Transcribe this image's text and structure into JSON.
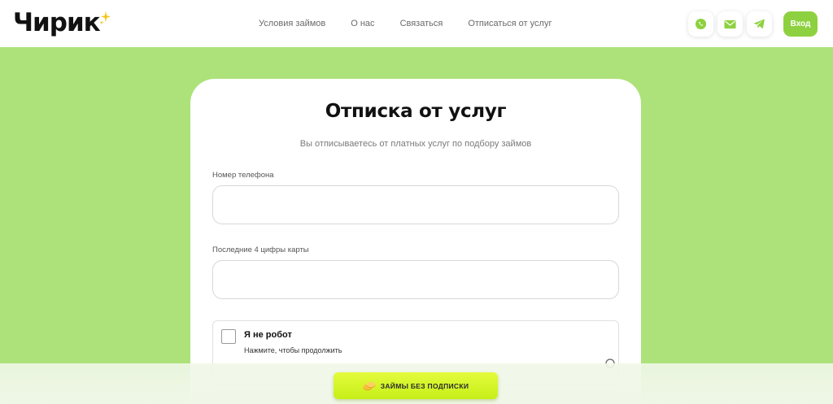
{
  "header": {
    "logo_text": "Чирик",
    "nav": [
      {
        "label": "Условия займов"
      },
      {
        "label": "О нас"
      },
      {
        "label": "Связаться"
      },
      {
        "label": "Отписаться от услуг"
      }
    ],
    "contact_icons": [
      "whatsapp-icon",
      "mail-icon",
      "telegram-icon"
    ],
    "login_label": "Вход"
  },
  "form": {
    "title": "Отписка от услуг",
    "subtitle": "Вы отписываетесь от платных услуг по подбору займов",
    "phone_label": "Номер телефона",
    "phone_value": "",
    "card_label": "Последние 4 цифры карты",
    "card_value": ""
  },
  "captcha": {
    "title": "Я не робот",
    "subtitle": "Нажмите, чтобы продолжить",
    "checked": false
  },
  "cta": {
    "label": "ЗАЙМЫ БЕЗ ПОДПИСКИ"
  },
  "colors": {
    "page_background": "#ade27a",
    "accent_green": "#8ed140",
    "cta_yellow": "#d6f528",
    "logo_star": "#f2c61c"
  }
}
